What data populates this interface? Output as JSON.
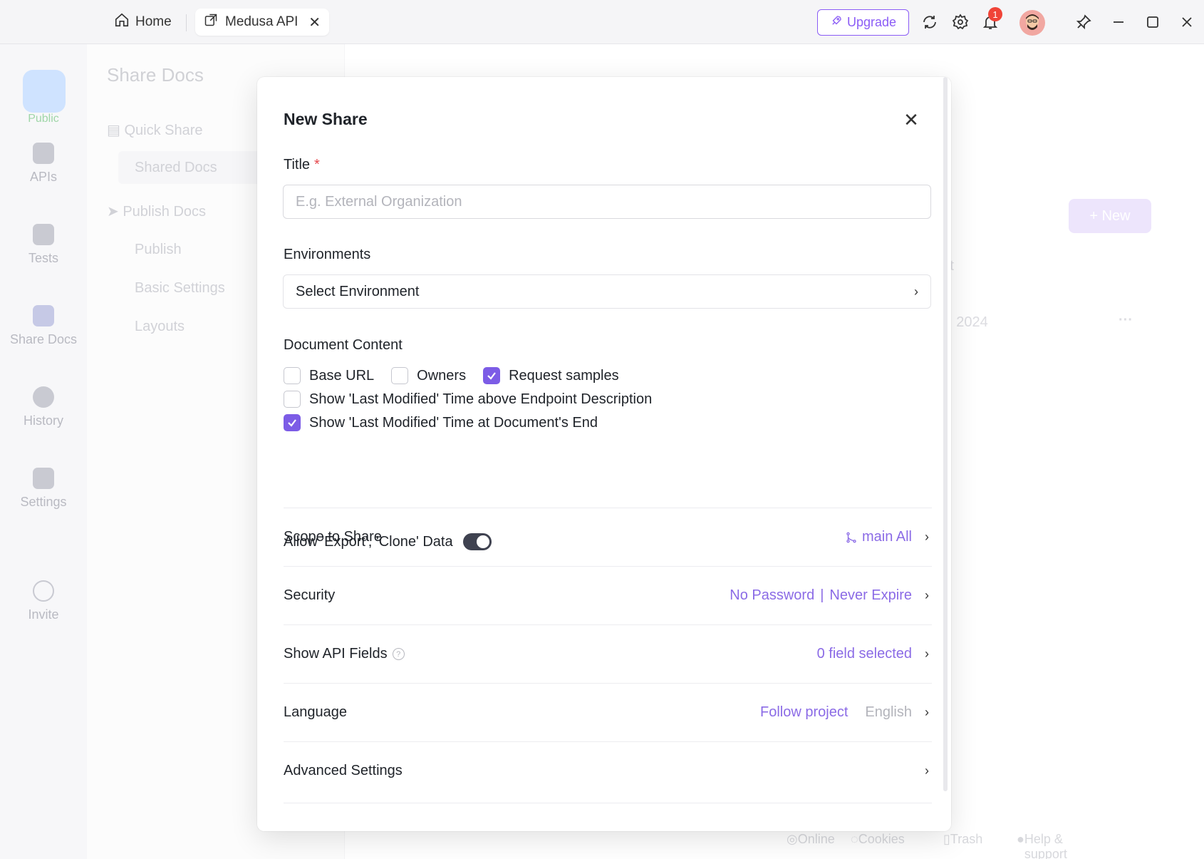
{
  "tabs": {
    "home": "Home",
    "active": "Medusa API",
    "close_glyph": "✕"
  },
  "toolbar": {
    "upgrade": "Upgrade",
    "notification_count": "1"
  },
  "leftnav": {
    "logo_label": "Public",
    "items": [
      "APIs",
      "Tests",
      "Share Docs",
      "History",
      "Settings",
      "Invite"
    ]
  },
  "subnav": {
    "title": "Share Docs",
    "quick_share": "Quick Share",
    "shared_docs": "Shared Docs",
    "publish_docs": "Publish Docs",
    "publish": "Publish",
    "basic_settings": "Basic Settings",
    "layouts": "Layouts"
  },
  "background": {
    "new_button": "+ New",
    "col_at": "At",
    "date": "5, 2024",
    "more": "···"
  },
  "modal": {
    "title": "New Share",
    "close_glyph": "✕",
    "title_label": "Title",
    "required_mark": "*",
    "title_placeholder": "E.g. External Organization",
    "env_label": "Environments",
    "env_value": "Select Environment",
    "content_label": "Document Content",
    "checkboxes": {
      "base_url": "Base URL",
      "owners": "Owners",
      "request_samples": "Request samples",
      "last_mod_above": "Show 'Last Modified' Time above Endpoint Description",
      "last_mod_end": "Show 'Last Modified' Time at Document's End"
    },
    "allow_label": "Allow 'Export', 'Clone' Data",
    "scope": {
      "label": "Scope to Share",
      "value": "main All"
    },
    "security": {
      "label": "Security",
      "password": "No Password",
      "separator": "|",
      "expire": "Never Expire"
    },
    "api_fields": {
      "label": "Show API Fields",
      "value": "0 field selected",
      "help": "?"
    },
    "language": {
      "label": "Language",
      "value": "Follow project",
      "sub": "English"
    },
    "advanced": {
      "label": "Advanced Settings"
    }
  },
  "footer": {
    "online": "Online",
    "cookies": "Cookies",
    "trash": "Trash",
    "help": "Help & support"
  },
  "colors": {
    "accent": "#7c5ce6",
    "link": "#8b6be6",
    "required": "#e5484d",
    "badge": "#f04438"
  }
}
